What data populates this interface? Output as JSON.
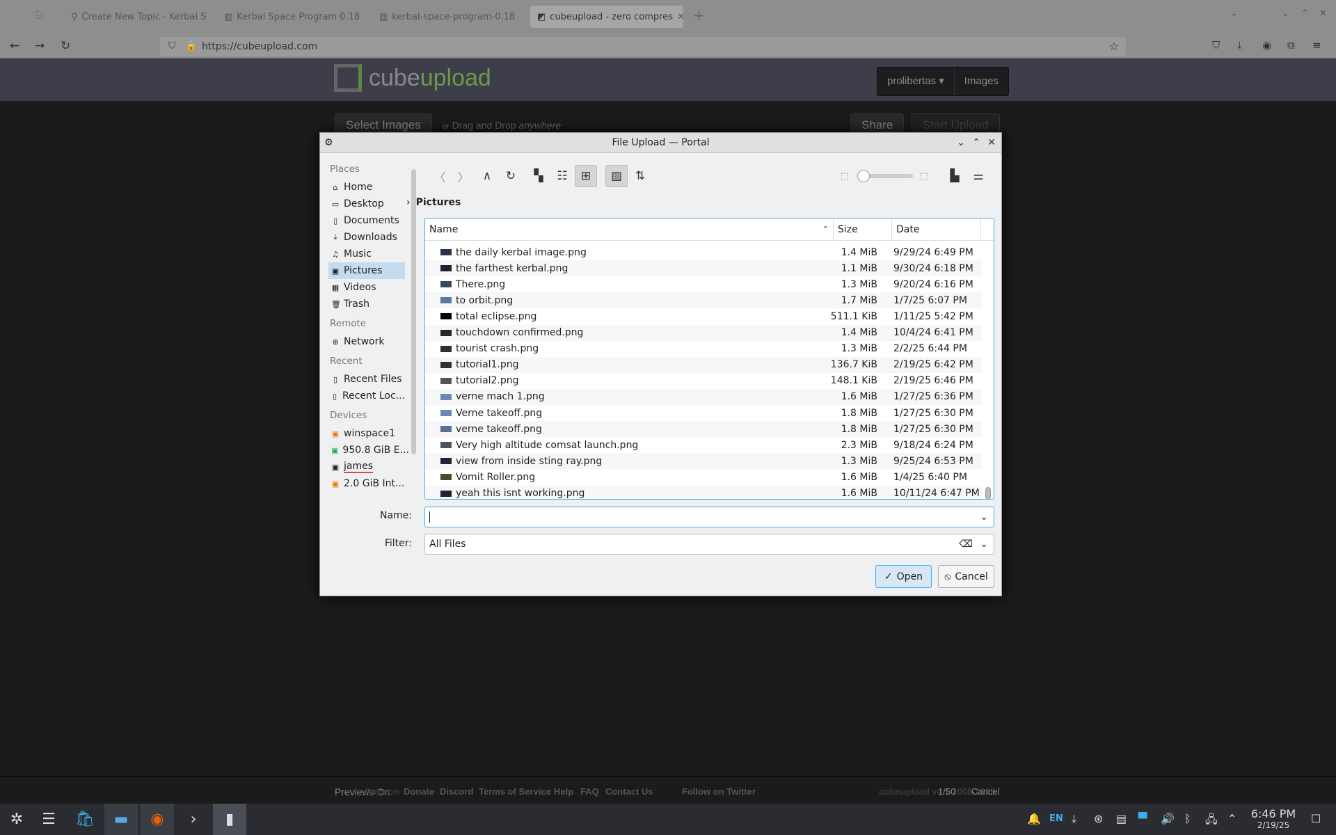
{
  "browser": {
    "tabs": [
      {
        "title": "Create New Topic - Kerbal S"
      },
      {
        "title": "Kerbal Space Program 0.18"
      },
      {
        "title": "kerbal-space-program-0.18"
      },
      {
        "title": "cubeupload - zero compres"
      }
    ],
    "url": "https://cubeupload.com"
  },
  "site": {
    "logo_a": "cube",
    "logo_b": "upload",
    "user_menu": "prolibertas ▾",
    "images": "Images",
    "select_images": "Select Images",
    "drag_hint_a": "or",
    "drag_hint_b": "Drag and Drop",
    "drag_hint_c": "anywhere",
    "share": "Share",
    "start_upload": "Start Upload",
    "footer": {
      "previews": "Previews On",
      "links": [
        "Patreon",
        "Donate",
        "Discord",
        "Terms of Service",
        "Help",
        "FAQ",
        "Contact Us",
        "Follow on Twitter"
      ],
      "version": "cubeupload v4.1 2008-2025",
      "count": "1/50",
      "cancel": "Cancel"
    }
  },
  "dialog": {
    "title": "File Upload — Portal",
    "sidebar": {
      "sections": [
        {
          "label": "Places",
          "items": [
            {
              "label": "Home",
              "icon": "⌂"
            },
            {
              "label": "Desktop",
              "icon": "▭"
            },
            {
              "label": "Documents",
              "icon": "▯"
            },
            {
              "label": "Downloads",
              "icon": "⤓"
            },
            {
              "label": "Music",
              "icon": "♫"
            },
            {
              "label": "Pictures",
              "icon": "▣",
              "selected": true
            },
            {
              "label": "Videos",
              "icon": "▦"
            },
            {
              "label": "Trash",
              "icon": "🗑"
            }
          ]
        },
        {
          "label": "Remote",
          "items": [
            {
              "label": "Network",
              "icon": "⊕"
            }
          ]
        },
        {
          "label": "Recent",
          "items": [
            {
              "label": "Recent Files",
              "icon": "▯"
            },
            {
              "label": "Recent Loc...",
              "icon": "▯"
            }
          ]
        },
        {
          "label": "Devices",
          "items": [
            {
              "label": "winspace1",
              "icon": "▣"
            },
            {
              "label": "950.8 GiB E...",
              "icon": "▣"
            },
            {
              "label": "james",
              "icon": "▣"
            },
            {
              "label": "2.0 GiB Int...",
              "icon": "▣"
            }
          ]
        }
      ]
    },
    "breadcrumb": "Pictures",
    "columns": [
      "Name",
      "Size",
      "Date"
    ],
    "files": [
      {
        "name": "the daily kerbal image.png",
        "size": "1.4 MiB",
        "date": "9/29/24 6:49 PM"
      },
      {
        "name": "the farthest kerbal.png",
        "size": "1.1 MiB",
        "date": "9/30/24 6:18 PM"
      },
      {
        "name": "There.png",
        "size": "1.3 MiB",
        "date": "9/20/24 6:16 PM"
      },
      {
        "name": "to orbit.png",
        "size": "1.7 MiB",
        "date": "1/7/25 6:07 PM"
      },
      {
        "name": "total eclipse.png",
        "size": "511.1 KiB",
        "date": "1/11/25 5:42 PM"
      },
      {
        "name": "touchdown confirmed.png",
        "size": "1.4 MiB",
        "date": "10/4/24 6:41 PM"
      },
      {
        "name": "tourist crash.png",
        "size": "1.3 MiB",
        "date": "2/2/25 6:44 PM"
      },
      {
        "name": "tutorial1.png",
        "size": "136.7 KiB",
        "date": "2/19/25 6:42 PM"
      },
      {
        "name": "tutorial2.png",
        "size": "148.1 KiB",
        "date": "2/19/25 6:46 PM"
      },
      {
        "name": "verne mach 1.png",
        "size": "1.6 MiB",
        "date": "1/27/25 6:36 PM"
      },
      {
        "name": "Verne takeoff.png",
        "size": "1.8 MiB",
        "date": "1/27/25 6:30 PM"
      },
      {
        "name": "verne takeoff.png",
        "size": "1.8 MiB",
        "date": "1/27/25 6:30 PM"
      },
      {
        "name": "Very high altitude comsat launch.png",
        "size": "2.3 MiB",
        "date": "9/18/24 6:24 PM"
      },
      {
        "name": "view from inside sting ray.png",
        "size": "1.3 MiB",
        "date": "9/25/24 6:53 PM"
      },
      {
        "name": "Vomit Roller.png",
        "size": "1.6 MiB",
        "date": "1/4/25 6:40 PM"
      },
      {
        "name": "yeah this isnt working.png",
        "size": "1.6 MiB",
        "date": "10/11/24 6:47 PM"
      }
    ],
    "name_label": "Name:",
    "name_value": "",
    "filter_label": "Filter:",
    "filter_value": "All Files",
    "open": "Open",
    "cancel": "Cancel",
    "zoom_slider_level": 0
  },
  "taskbar": {
    "lang": "EN",
    "time": "6:46 PM",
    "date": "2/19/25"
  }
}
